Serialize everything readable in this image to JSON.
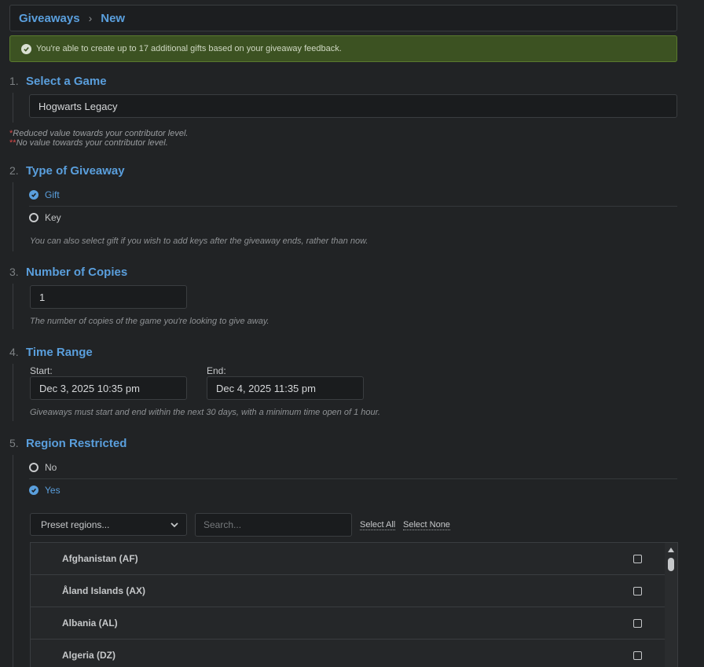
{
  "breadcrumb": {
    "root": "Giveaways",
    "separator": "›",
    "current": "New"
  },
  "notice": {
    "text": "You're able to create up to 17 additional gifts based on your giveaway feedback."
  },
  "sections": {
    "game": {
      "num": "1.",
      "title": "Select a Game",
      "value": "Hogwarts Legacy"
    },
    "type": {
      "num": "2.",
      "title": "Type of Giveaway"
    },
    "copies": {
      "num": "3.",
      "title": "Number of Copies"
    },
    "time": {
      "num": "4.",
      "title": "Time Range"
    },
    "region": {
      "num": "5.",
      "title": "Region Restricted"
    }
  },
  "contributor_notes": {
    "reduced_star": "*",
    "reduced_text": "Reduced value towards your contributor level.",
    "no_value_star": "**",
    "no_value_text": "No value towards your contributor level."
  },
  "giveaway_type": {
    "options": [
      {
        "label": "Gift",
        "selected": true
      },
      {
        "label": "Key",
        "selected": false
      }
    ],
    "hint": "You can also select gift if you wish to add keys after the giveaway ends, rather than now."
  },
  "copies": {
    "value": "1",
    "hint": "The number of copies of the game you're looking to give away."
  },
  "time_range": {
    "start_label": "Start:",
    "start_value": "Dec 3, 2025 10:35 pm",
    "end_label": "End:",
    "end_value": "Dec 4, 2025 11:35 pm",
    "hint": "Giveaways must start and end within the next 30 days, with a minimum time open of 1 hour."
  },
  "region": {
    "options": [
      {
        "label": "No",
        "selected": false
      },
      {
        "label": "Yes",
        "selected": true
      }
    ],
    "preset_placeholder": "Preset regions...",
    "search_placeholder": "Search...",
    "select_all": "Select All",
    "select_none": "Select None",
    "countries": [
      {
        "name": "Afghanistan (AF)",
        "checked": false
      },
      {
        "name": "Åland Islands (AX)",
        "checked": false
      },
      {
        "name": "Albania (AL)",
        "checked": false
      },
      {
        "name": "Algeria (DZ)",
        "checked": false
      }
    ]
  },
  "colors": {
    "accent": "#5a9fdd",
    "notice_bg": "#3c5222",
    "background": "#212325"
  }
}
